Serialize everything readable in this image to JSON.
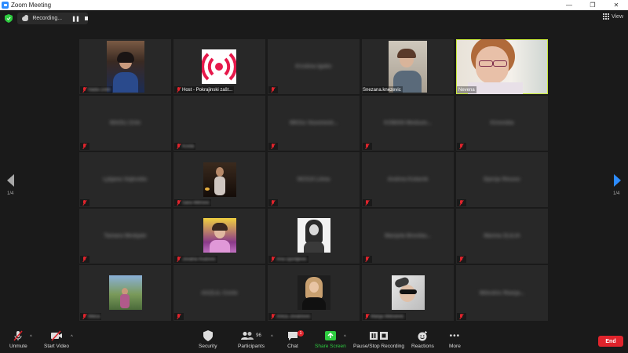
{
  "window": {
    "title": "Zoom Meeting"
  },
  "topbar": {
    "recording_label": "Recording...",
    "view_label": "View"
  },
  "pagination": {
    "left": "1/4",
    "right": "1/4"
  },
  "tiles": [
    {
      "name": "Nada Dobr",
      "blur_label": true,
      "video": true,
      "active": false
    },
    {
      "name": "Host - Pokrajinski zašt...",
      "blur_label": false,
      "video": true,
      "active": false
    },
    {
      "name": "Kristina Igatic",
      "blur_label": true,
      "video": false,
      "active": false,
      "center_blur": "Kristina Igatic"
    },
    {
      "name": "Snezana.knezevic",
      "blur_label": false,
      "video": true,
      "active": false
    },
    {
      "name": "Nevena",
      "blur_label": false,
      "video": true,
      "active": true
    },
    {
      "name": "MAOLI Zrile",
      "blur_label": true,
      "video": false,
      "center_blur": "MAOLI Zrile"
    },
    {
      "name": "Kosta",
      "blur_label": true,
      "video": false,
      "center_blur": ""
    },
    {
      "name": "MKGu Vozomeid...",
      "blur_label": true,
      "video": false,
      "center_blur": "MKGu Vozomeid..."
    },
    {
      "name": "KOMAN Medium...",
      "blur_label": true,
      "video": false,
      "center_blur": "KOMAN Medium..."
    },
    {
      "name": "Kirovidia",
      "blur_label": true,
      "video": false,
      "center_blur": "Kirovidia"
    },
    {
      "name": "Ljiljana Vojkvidic",
      "blur_label": true,
      "video": false,
      "center_blur": "Ljiljana Vojkvidic"
    },
    {
      "name": "Sara Mitrovic",
      "blur_label": true,
      "video": true
    },
    {
      "name": "NCOJI Lilina",
      "blur_label": true,
      "video": false,
      "center_blur": "NCOJI Lilina"
    },
    {
      "name": "Andrea Kolarek",
      "blur_label": true,
      "video": false,
      "center_blur": "Andrea Kolarek"
    },
    {
      "name": "Djorije Reusic",
      "blur_label": true,
      "video": false,
      "center_blur": "Djorije Reusic"
    },
    {
      "name": "Tamara Medijale",
      "blur_label": true,
      "video": false,
      "center_blur": "Tamara Medijale"
    },
    {
      "name": "Jovana Rudovic",
      "blur_label": true,
      "video": true
    },
    {
      "name": "Ana Djordjevic",
      "blur_label": true,
      "video": true
    },
    {
      "name": "Marijela Brezika...",
      "blur_label": true,
      "video": false,
      "center_blur": "Marijela Brezika..."
    },
    {
      "name": "Marina ZLILIA",
      "blur_label": true,
      "video": false,
      "center_blur": "Marina ZLILIA"
    },
    {
      "name": "Milica",
      "blur_label": true,
      "video": true
    },
    {
      "name": "AGZLIL Cirele",
      "blur_label": true,
      "video": false,
      "center_blur": "AGZLIL Cirele"
    },
    {
      "name": "Anica Jovanovic",
      "blur_label": true,
      "video": true
    },
    {
      "name": "Marija Milosevic",
      "blur_label": true,
      "video": true
    },
    {
      "name": "Milicdric Rianja...",
      "blur_label": true,
      "video": false,
      "center_blur": "Milicdric Rianja..."
    }
  ],
  "toolbar": {
    "unmute": "Unmute",
    "start_video": "Start Video",
    "security": "Security",
    "participants": "Participants",
    "participants_count": "96",
    "chat": "Chat",
    "chat_badge": "1",
    "share_screen": "Share Screen",
    "pause_stop": "Pause/Stop Recording",
    "reactions": "Reactions",
    "more": "More",
    "end": "End"
  },
  "colors": {
    "accent": "#2d8cff",
    "active_speaker": "#c8e83a",
    "mute": "#e0242c",
    "share": "#2ecc40"
  }
}
